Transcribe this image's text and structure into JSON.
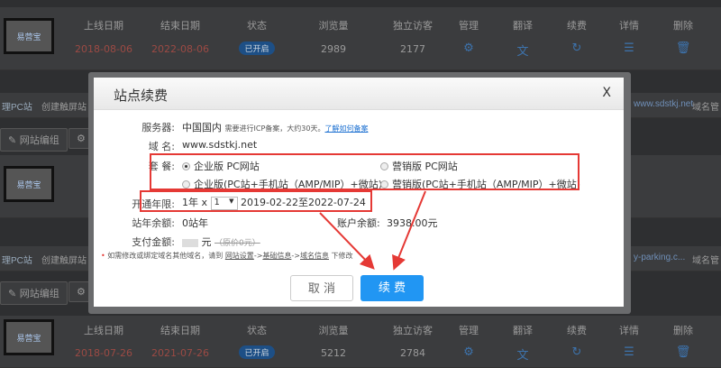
{
  "table_header": [
    "上线日期",
    "结束日期",
    "状态",
    "浏览量",
    "独立访客",
    "管理",
    "翻译",
    "续费",
    "详情",
    "删除"
  ],
  "logo_text": "易营宝",
  "rows": [
    {
      "start": "2018-08-06",
      "end": "2022-08-06",
      "status": "已开启",
      "views": "2989",
      "visitors": "2177"
    },
    {
      "start": "2018-07-26",
      "end": "2021-07-26",
      "status": "已开启",
      "views": "5212",
      "visitors": "2784"
    }
  ],
  "tabs": [
    {
      "active": "理PC站",
      "create": "创建触屏站",
      "domain": "www.sdstkj.net",
      "domain_btn": "域名管"
    },
    {
      "active": "理PC站",
      "create": "创建触屏站",
      "domain": "y-parking.c...",
      "domain_btn": "域名管"
    }
  ],
  "toolbar": {
    "group": "网站编组"
  },
  "icons": {
    "manage": "user-gear-icon",
    "translate": "translate-icon",
    "renew": "renew-icon",
    "detail": "detail-icon",
    "delete": "trash-icon"
  },
  "modal": {
    "title": "站点续费",
    "close": "X",
    "server_label": "服务器:",
    "server_value": "中国国内",
    "server_note": "需要进行ICP备案，大约30天。",
    "server_link": "了解如何备案",
    "domain_label": "域 名:",
    "domain_value": "www.sdstkj.net",
    "package_label": "套 餐:",
    "packages": [
      "企业版 PC网站",
      "营销版 PC网站",
      "企业版(PC站+手机站（AMP/MIP）+微站)",
      "营销版(PC站+手机站（AMP/MIP）+微站)"
    ],
    "term_label": "开通年限:",
    "term_unit": "1年 x",
    "term_select": "1",
    "term_range": "2019-02-22至2022-07-24",
    "remain_label": "站年余额:",
    "remain_value": "0站年",
    "balance_label": "账户余额:",
    "balance_value": "3938.00元",
    "pay_label": "支付金额:",
    "pay_unit": "元",
    "pay_original": "（原价0元）",
    "note": "如需修改或绑定域名其他域名，请到",
    "note_link1": "网站设置",
    "note_link2": "基础信息",
    "note_link3": "域名信息",
    "note_end": "下修改",
    "arrow": "->",
    "cancel": "取 消",
    "confirm": "续 费"
  },
  "colors": {
    "accent": "#2196f3",
    "annotation": "#e53935"
  }
}
